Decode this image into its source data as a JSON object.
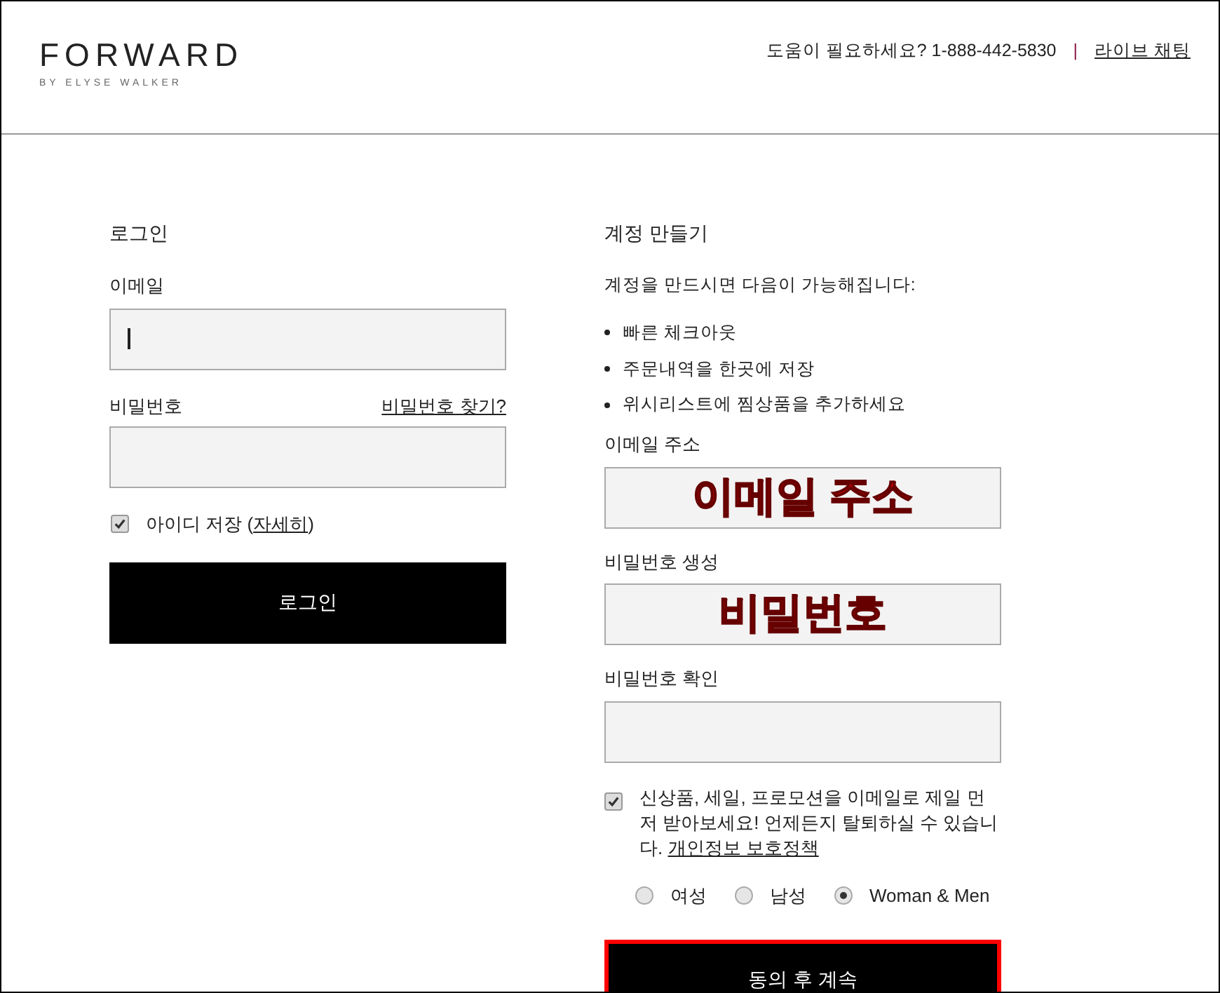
{
  "header": {
    "logo": "FORWARD",
    "logo_tagline": "BY ELYSE WALKER",
    "help_text": "도움이 필요하세요? 1-888-442-5830",
    "separator": "|",
    "chat_link": "라이브 채팅"
  },
  "login": {
    "title": "로그인",
    "email_label": "이메일",
    "password_label": "비밀번호",
    "forgot_link": "비밀번호 찾기?",
    "remember": {
      "label": "아이디 저장 (",
      "link": "자세히",
      "suffix": ")",
      "checked": true
    },
    "button": "로그인"
  },
  "signup": {
    "title": "계정 만들기",
    "intro": "계정을 만드시면 다음이 가능해집니다:",
    "benefits": [
      "빠른 체크아웃",
      "주문내역을 한곳에 저장",
      "위시리스트에 찜상품을 추가하세요"
    ],
    "fields": [
      {
        "label": "이메일 주소",
        "value": "이메일 주소"
      },
      {
        "label": "비밀번호 생성",
        "value": "비밀번호"
      },
      {
        "label": "비밀번호 확인"
      }
    ],
    "newsletter": {
      "text": "신상품, 세일, 프로모션을 이메일로 제일 먼저 받아보세요! 언제든지 탈퇴하실 수 있습니다.",
      "link": "개인정보 보호정책",
      "checked": true
    },
    "genders": [
      {
        "label": "여성",
        "selected": false
      },
      {
        "label": "남성",
        "selected": false
      },
      {
        "label": "Woman & Men",
        "selected": true
      }
    ],
    "button": "동의 후 계속"
  }
}
